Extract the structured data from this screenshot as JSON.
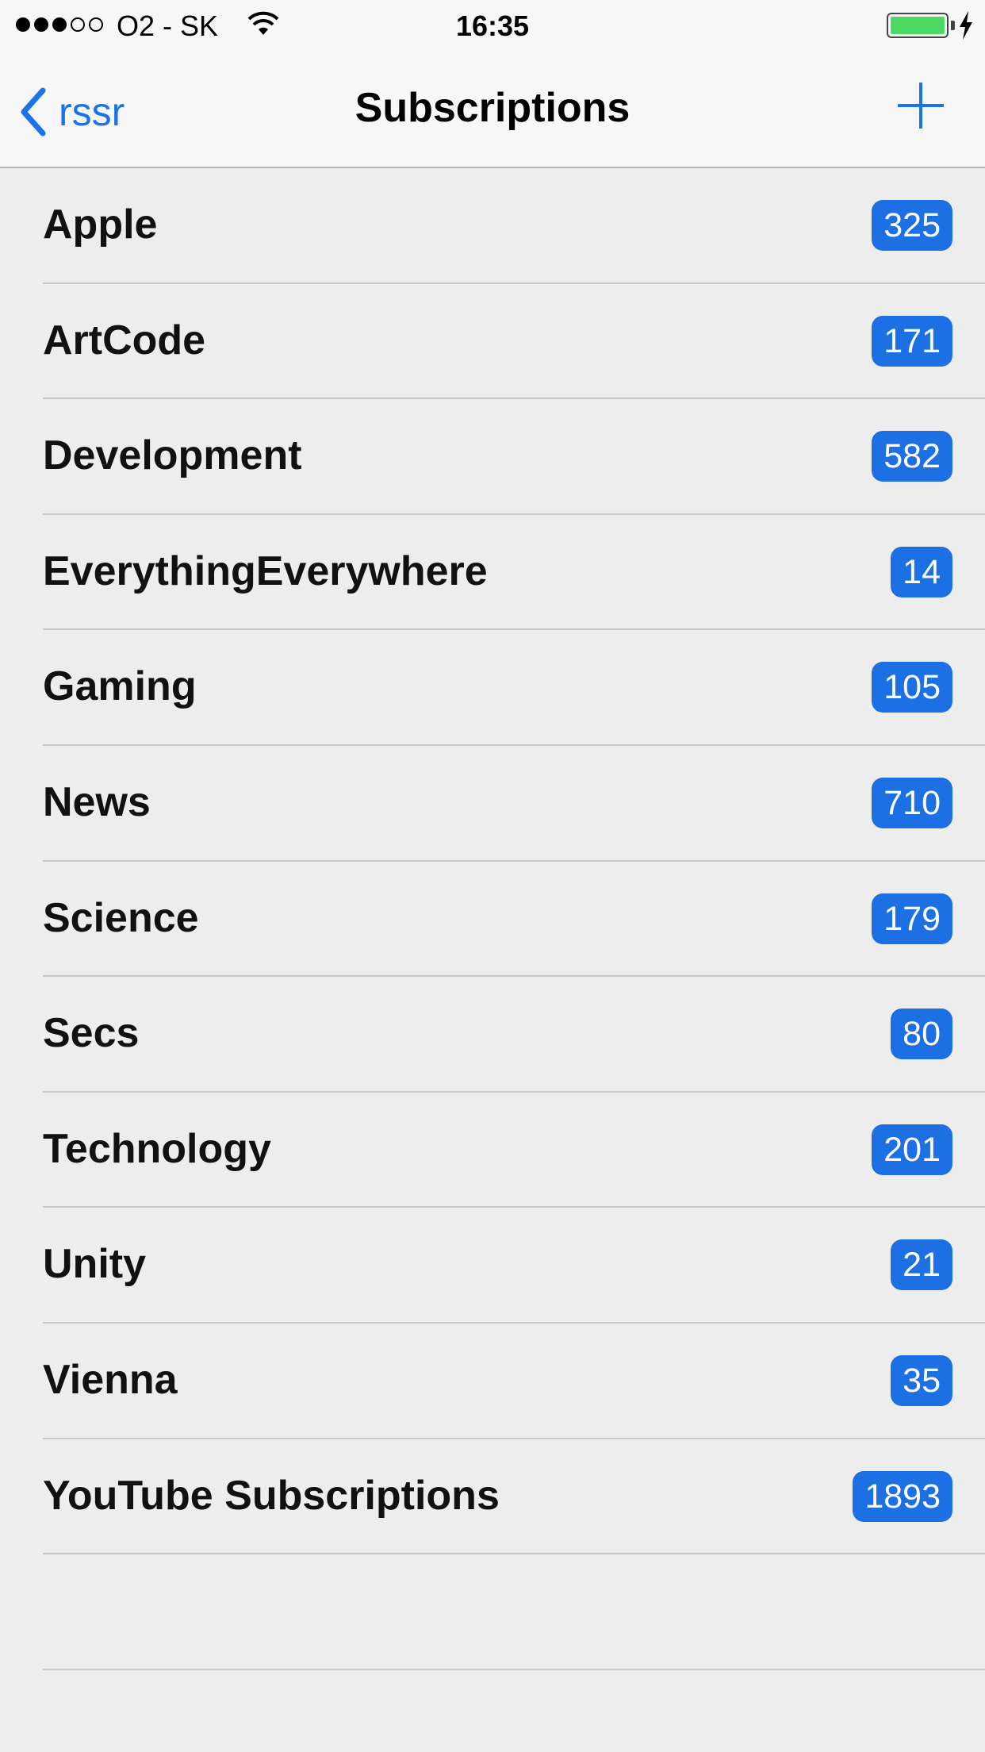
{
  "status_bar": {
    "signal_dots_filled": 3,
    "signal_dots_total": 5,
    "carrier": "O2 - SK",
    "time": "16:35",
    "wifi_icon": "wifi-icon",
    "battery_level": 1.0,
    "charging": true,
    "battery_color": "#4cd964"
  },
  "nav": {
    "back_label": "rssr",
    "title": "Subscriptions",
    "add_icon": "plus-icon",
    "accent_color": "#1a73e8"
  },
  "subscriptions": [
    {
      "name": "Apple",
      "count": "325"
    },
    {
      "name": "ArtCode",
      "count": "171"
    },
    {
      "name": "Development",
      "count": "582"
    },
    {
      "name": "EverythingEverywhere",
      "count": "14"
    },
    {
      "name": "Gaming",
      "count": "105"
    },
    {
      "name": "News",
      "count": "710"
    },
    {
      "name": "Science",
      "count": "179"
    },
    {
      "name": "Secs",
      "count": "80"
    },
    {
      "name": "Technology",
      "count": "201"
    },
    {
      "name": "Unity",
      "count": "21"
    },
    {
      "name": "Vienna",
      "count": "35"
    },
    {
      "name": "YouTube Subscriptions",
      "count": "1893"
    }
  ]
}
